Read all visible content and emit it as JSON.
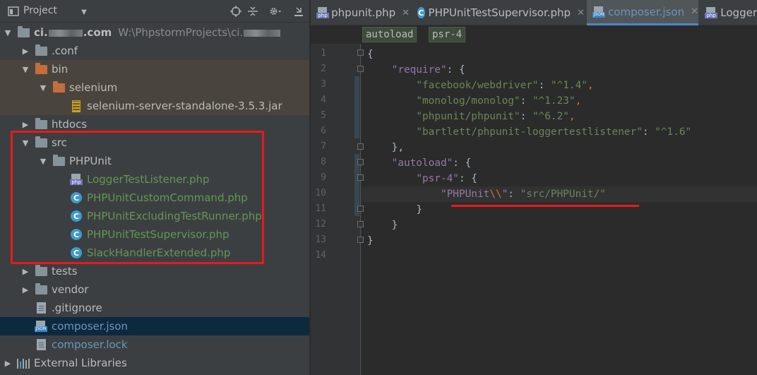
{
  "pane": {
    "title": "Project",
    "dropdown_glyph": "▼",
    "icons": [
      "project-view-icon",
      "locate-icon",
      "collapse-all-icon",
      "settings-gear-icon",
      "hide-panel-icon"
    ]
  },
  "tree": [
    {
      "label": "ci.",
      "label_tail": ".com",
      "suffix": "W:\\PhpstormProjects\\ci.",
      "icon": "module-folder",
      "arrow": "▼",
      "level": 0
    },
    {
      "label": ".conf",
      "icon": "folder",
      "arrow": "▶",
      "level": 1
    },
    {
      "label": "bin",
      "icon": "folder-excluded",
      "arrow": "▼",
      "level": 1
    },
    {
      "label": "selenium",
      "icon": "folder-excluded",
      "arrow": "▼",
      "level": 2
    },
    {
      "label": "selenium-server-standalone-3.5.3.jar",
      "icon": "jar-file",
      "arrow": "",
      "level": 3
    },
    {
      "label": "htdocs",
      "icon": "folder",
      "arrow": "▶",
      "level": 1
    },
    {
      "label": "src",
      "icon": "folder",
      "arrow": "▼",
      "level": 1
    },
    {
      "label": "PHPUnit",
      "icon": "folder",
      "arrow": "▼",
      "level": 2
    },
    {
      "label": "LoggerTestListener.php",
      "icon": "php-file",
      "arrow": "",
      "level": 3
    },
    {
      "label": "PHPUnitCustomCommand.php",
      "icon": "class",
      "arrow": "",
      "level": 3
    },
    {
      "label": "PHPUnitExcludingTestRunner.php",
      "icon": "class",
      "arrow": "",
      "level": 3
    },
    {
      "label": "PHPUnitTestSupervisor.php",
      "icon": "class",
      "arrow": "",
      "level": 3
    },
    {
      "label": "SlackHandlerExtended.php",
      "icon": "class",
      "arrow": "",
      "level": 3
    },
    {
      "label": "tests",
      "icon": "folder",
      "arrow": "▶",
      "level": 1
    },
    {
      "label": "vendor",
      "icon": "folder",
      "arrow": "▶",
      "level": 1
    },
    {
      "label": ".gitignore",
      "icon": "text-file",
      "arrow": "",
      "level": 1
    },
    {
      "label": "composer.json",
      "icon": "json-file",
      "arrow": "",
      "level": 1
    },
    {
      "label": "composer.lock",
      "icon": "text-file",
      "arrow": "",
      "level": 1
    },
    {
      "label": "External Libraries",
      "icon": "libraries",
      "arrow": "▶",
      "level": 0
    }
  ],
  "tabs": [
    {
      "label": "phpunit.php",
      "icon": "php",
      "close": "✕"
    },
    {
      "label": "PHPUnitTestSupervisor.php",
      "icon": "class",
      "close": "✕"
    },
    {
      "label": "composer.json",
      "icon": "json",
      "close": "✕",
      "active": true
    },
    {
      "label": "Logger",
      "icon": "php",
      "close": ""
    }
  ],
  "breadcrumbs": [
    "autoload",
    "psr-4"
  ],
  "line_numbers": [
    "1",
    "2",
    "3",
    "4",
    "5",
    "6",
    "7",
    "8",
    "9",
    "10",
    "11",
    "12",
    "13",
    "14"
  ],
  "code": {
    "l1": "{",
    "l2_key": "\"require\"",
    "l2_rest": ": {",
    "l3_key": "\"facebook/webdriver\"",
    "l3_sep": ": ",
    "l3_val": "\"^1.4\"",
    "l3_end": ",",
    "l4_key": "\"monolog/monolog\"",
    "l4_sep": ": ",
    "l4_val": "\"^1.23\"",
    "l4_end": ",",
    "l5_key": "\"phpunit/phpunit\"",
    "l5_sep": ": ",
    "l5_val": "\"^6.2\"",
    "l5_end": ",",
    "l6_key": "\"bartlett/phpunit-loggertestlistener\"",
    "l6_sep": ": ",
    "l6_val": "\"^1.6\"",
    "l7": "},",
    "l8_key": "\"autoload\"",
    "l8_rest": ": {",
    "l9_key": "\"psr-4\"",
    "l9_rest": ": {",
    "l10_key_a": "\"PHPUnit",
    "l10_esc": "\\\\",
    "l10_key_b": "\"",
    "l10_sep": ": ",
    "l10_val": "\"src/PHPUnit/\"",
    "l11": "}",
    "l12": "}",
    "l13": "}"
  },
  "colors": {
    "accent_annotation": "#e8191c",
    "json_key": "#9876aa",
    "json_string": "#6a8759",
    "escape": "#cc7832"
  }
}
